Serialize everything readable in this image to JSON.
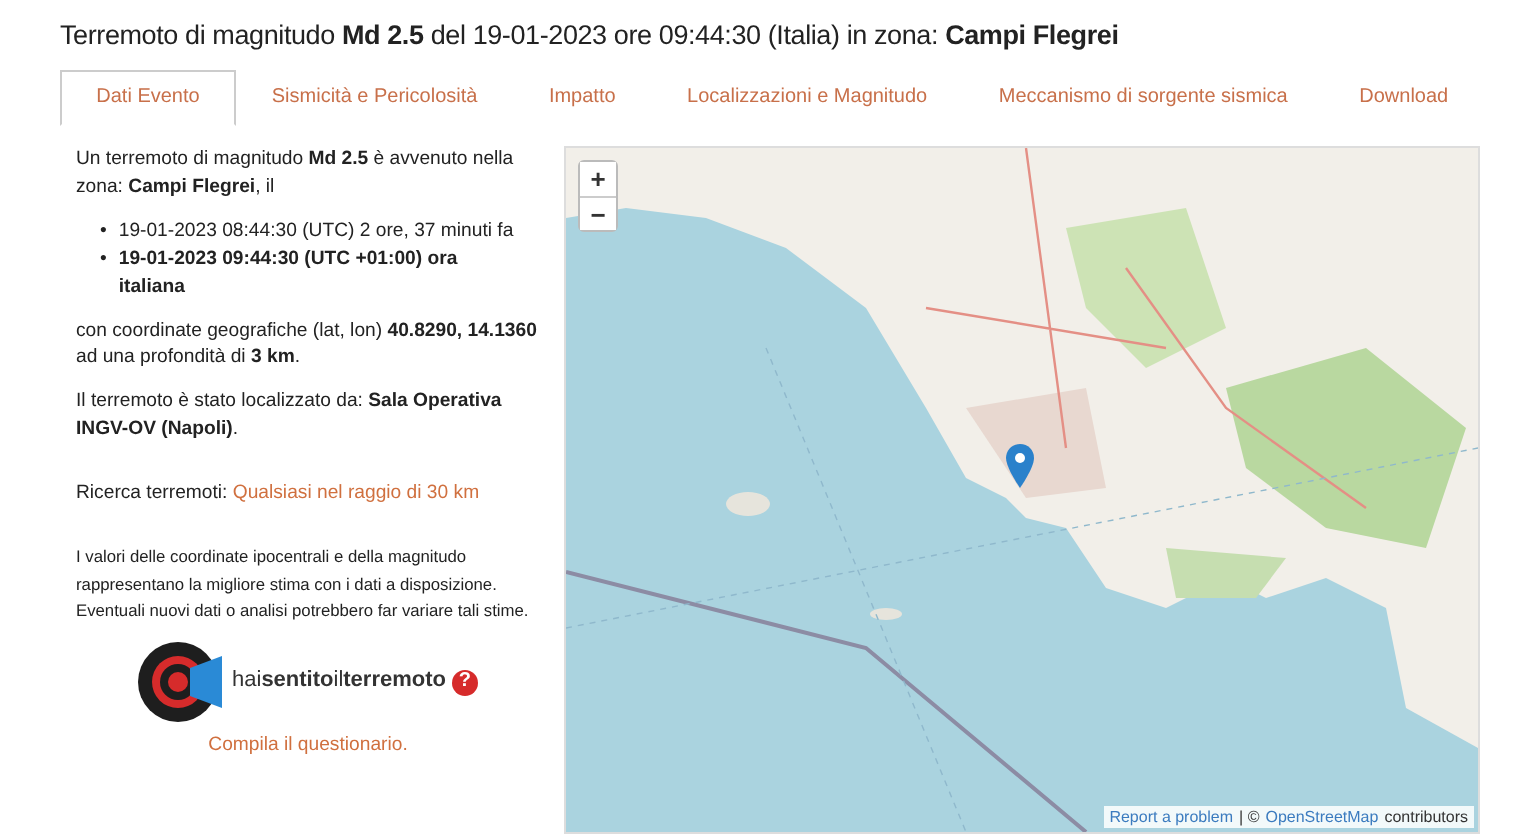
{
  "title": "Terremoto di magnitudo **Md 2.5** del 19-01-2023 ore 09:44:30 (Italia) in zona: **Campi Flegrei**",
  "tabs": [
    {
      "label": "Dati Evento",
      "selected": true
    },
    {
      "label": "Sismicità e Pericolosità",
      "selected": false
    },
    {
      "label": "Impatto",
      "selected": false
    },
    {
      "label": "Localizzazioni e Magnitudo",
      "selected": false
    },
    {
      "label": "Meccanismo di sorgente sismica",
      "selected": false
    },
    {
      "label": "Download",
      "selected": false
    }
  ],
  "intro": "Un terremoto di magnitudo **Md 2.5** è avvenuto nella zona: **Campi Flegrei**, il",
  "times": [
    {
      "bullet": "•",
      "text": "19-01-2023 08:44:30 (UTC) 2 ore, 37 minuti fa"
    },
    {
      "bullet": "•",
      "text": "**19-01-2023 09:44:30 (UTC +01:00) ora italiana**"
    }
  ],
  "coordinates": "con coordinate geografiche (lat, lon) **40.8290, 14.1360** ad una profondità di **3 km**.",
  "located_by": "Il terremoto è stato localizzato da: **Sala Operativa INGV-OV (Napoli)**.",
  "search": {
    "label": "Ricerca terremoti:",
    "link": "Qualsiasi nel raggio di 30 km"
  },
  "disclaimer": "I valori delle coordinate ipocentrali e della magnitudo rappresentano la migliore stima con i dati a disposizione. Eventuali nuovi dati o analisi potrebbero far variare tali stime.",
  "survey": {
    "logo_text": "hai**sentito**il**terremoto**",
    "help": "?",
    "link": "Compila il questionario."
  },
  "map": {
    "zoom_in": "+",
    "zoom_out": "−",
    "attribution": {
      "report": "Report a problem",
      "copyright": "| ©",
      "osm": "OpenStreetMap",
      "contributors": "contributors"
    }
  }
}
